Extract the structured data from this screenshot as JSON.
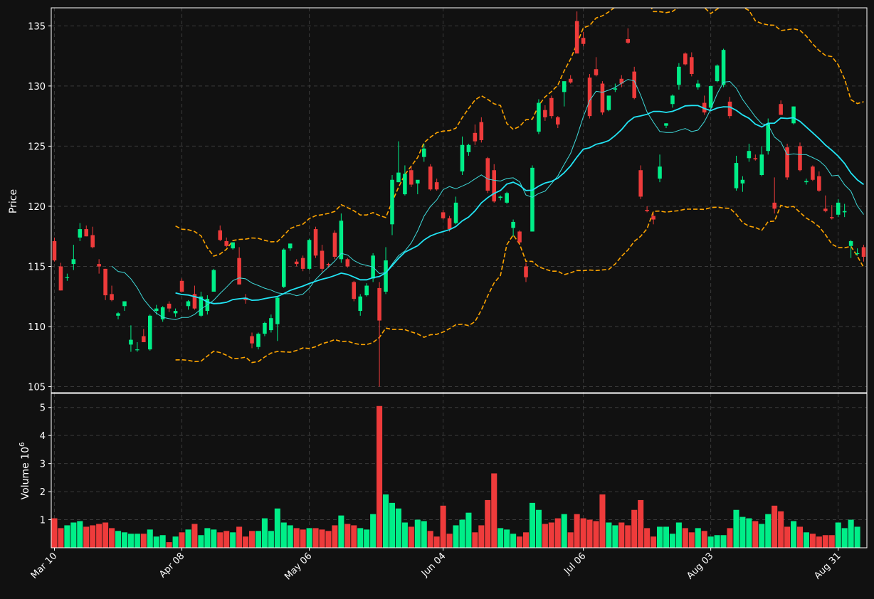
{
  "chart_data": [
    {
      "type": "candlestick",
      "panel": "price",
      "ylabel": "Price",
      "ylim": [
        104.5,
        136.5
      ],
      "yticks": [
        105,
        110,
        115,
        120,
        125,
        130,
        135
      ],
      "xtick_labels": [
        "Mar 10",
        "Apr 08",
        "May 06",
        "Jun 04",
        "Jul 06",
        "Aug 03",
        "Aug 31"
      ],
      "grid": true,
      "colors": {
        "up": "#00ee88",
        "down": "#ee3b3b",
        "mav_short": "#3fd9d9",
        "mav_long": "#22e5f5",
        "bollinger": "#ffa500",
        "background": "#111111",
        "grid": "#3a3a3a"
      },
      "ohlc": [
        [
          117.1,
          117.4,
          115.4,
          115.5
        ],
        [
          115.0,
          115.3,
          113.0,
          113.0
        ],
        [
          114.1,
          114.4,
          113.8,
          114.1
        ],
        [
          115.2,
          116.8,
          114.7,
          115.6
        ],
        [
          117.4,
          118.6,
          117.1,
          118.1
        ],
        [
          118.1,
          118.4,
          117.5,
          117.5
        ],
        [
          117.6,
          118.3,
          116.5,
          116.6
        ],
        [
          115.2,
          115.6,
          114.4,
          115.0
        ],
        [
          114.8,
          114.8,
          112.2,
          112.6
        ],
        [
          112.7,
          113.4,
          112.1,
          112.2
        ],
        [
          110.9,
          111.2,
          110.6,
          111.1
        ],
        [
          111.7,
          112.0,
          111.3,
          112.1
        ],
        [
          108.5,
          110.1,
          107.9,
          108.9
        ],
        [
          108.1,
          108.7,
          107.9,
          108.1
        ],
        [
          109.2,
          109.8,
          108.7,
          108.7
        ],
        [
          108.1,
          111.0,
          108.0,
          110.9
        ],
        [
          111.3,
          111.8,
          111.0,
          111.5
        ],
        [
          110.6,
          111.7,
          110.4,
          111.6
        ],
        [
          111.9,
          112.1,
          111.2,
          111.5
        ],
        [
          111.1,
          111.5,
          110.8,
          111.3
        ],
        [
          113.8,
          114.0,
          112.9,
          112.9
        ],
        [
          111.7,
          112.2,
          111.4,
          112.1
        ],
        [
          112.7,
          113.4,
          111.4,
          111.5
        ],
        [
          110.9,
          112.9,
          110.8,
          112.5
        ],
        [
          111.3,
          112.6,
          111.0,
          112.3
        ],
        [
          112.9,
          114.8,
          112.9,
          114.7
        ],
        [
          118.0,
          118.4,
          117.1,
          117.2
        ],
        [
          117.1,
          117.4,
          116.6,
          116.7
        ],
        [
          116.5,
          117.0,
          116.4,
          117.0
        ],
        [
          115.7,
          116.6,
          113.5,
          113.5
        ],
        [
          112.4,
          112.7,
          111.9,
          112.2
        ],
        [
          109.2,
          109.5,
          108.2,
          108.6
        ],
        [
          108.3,
          109.5,
          108.1,
          109.4
        ],
        [
          109.4,
          110.4,
          109.2,
          110.3
        ],
        [
          109.7,
          111.0,
          109.5,
          110.7
        ],
        [
          110.2,
          112.5,
          108.8,
          112.4
        ],
        [
          113.3,
          116.5,
          113.2,
          116.4
        ],
        [
          116.5,
          116.9,
          116.3,
          116.9
        ],
        [
          115.4,
          115.6,
          115.0,
          115.2
        ],
        [
          115.7,
          115.9,
          114.6,
          114.8
        ],
        [
          114.8,
          117.3,
          114.7,
          117.2
        ],
        [
          118.1,
          118.3,
          115.7,
          115.9
        ],
        [
          116.3,
          116.8,
          114.5,
          114.8
        ],
        [
          115.2,
          115.3,
          114.9,
          115.1
        ],
        [
          117.8,
          118.0,
          115.6,
          115.8
        ],
        [
          115.6,
          119.4,
          115.3,
          118.8
        ],
        [
          115.6,
          115.7,
          114.9,
          115.0
        ],
        [
          113.7,
          113.8,
          112.1,
          112.3
        ],
        [
          111.3,
          112.7,
          110.9,
          112.5
        ],
        [
          112.6,
          113.6,
          112.5,
          113.4
        ],
        [
          114.0,
          116.1,
          113.7,
          115.9
        ],
        [
          113.2,
          113.7,
          105.0,
          110.5
        ],
        [
          112.9,
          116.6,
          112.7,
          115.5
        ],
        [
          118.5,
          122.6,
          117.6,
          122.2
        ],
        [
          122.0,
          125.4,
          122.0,
          122.8
        ],
        [
          121.0,
          123.4,
          120.9,
          122.7
        ],
        [
          123.0,
          123.3,
          121.6,
          121.8
        ],
        [
          121.9,
          122.1,
          121.0,
          122.2
        ],
        [
          124.1,
          125.2,
          123.7,
          124.8
        ],
        [
          123.3,
          123.5,
          121.3,
          121.4
        ],
        [
          122.0,
          122.3,
          121.3,
          121.4
        ],
        [
          119.5,
          119.7,
          118.9,
          119.0
        ],
        [
          119.0,
          119.2,
          117.9,
          118.1
        ],
        [
          118.6,
          120.8,
          118.5,
          120.3
        ],
        [
          122.9,
          125.8,
          122.6,
          125.1
        ],
        [
          124.5,
          125.2,
          124.2,
          125.1
        ],
        [
          126.1,
          126.8,
          125.1,
          125.4
        ],
        [
          127.0,
          127.4,
          125.3,
          125.5
        ],
        [
          124.0,
          124.1,
          121.1,
          121.3
        ],
        [
          123.0,
          123.5,
          120.3,
          120.4
        ],
        [
          120.7,
          120.9,
          120.5,
          120.8
        ],
        [
          120.3,
          121.2,
          120.2,
          121.1
        ],
        [
          118.2,
          118.9,
          117.5,
          118.7
        ],
        [
          117.9,
          118.0,
          116.9,
          117.0
        ],
        [
          115.0,
          115.3,
          113.7,
          114.1
        ],
        [
          117.9,
          123.4,
          117.9,
          123.2
        ],
        [
          126.2,
          128.9,
          126.0,
          128.6
        ],
        [
          128.0,
          128.4,
          127.1,
          127.4
        ],
        [
          129.0,
          129.2,
          127.3,
          127.5
        ],
        [
          127.4,
          127.5,
          126.5,
          126.8
        ],
        [
          129.5,
          130.3,
          128.3,
          130.4
        ],
        [
          130.6,
          130.9,
          130.2,
          130.3
        ],
        [
          135.4,
          136.2,
          132.8,
          132.7
        ],
        [
          134.0,
          134.5,
          133.3,
          133.5
        ],
        [
          130.7,
          131.0,
          127.3,
          127.5
        ],
        [
          131.4,
          132.4,
          130.8,
          130.9
        ],
        [
          130.2,
          130.4,
          127.6,
          127.8
        ],
        [
          128.0,
          129.1,
          127.9,
          129.2
        ],
        [
          129.7,
          130.2,
          129.5,
          129.8
        ],
        [
          130.6,
          130.9,
          129.9,
          130.2
        ],
        [
          133.9,
          134.8,
          133.5,
          133.6
        ],
        [
          131.2,
          131.6,
          128.9,
          129.0
        ],
        [
          123.0,
          123.4,
          120.6,
          120.8
        ],
        [
          119.7,
          120.0,
          119.5,
          119.6
        ],
        [
          119.2,
          119.4,
          118.5,
          118.9
        ],
        [
          122.3,
          124.3,
          122.0,
          123.3
        ],
        [
          126.7,
          126.9,
          126.5,
          126.9
        ],
        [
          128.5,
          129.3,
          128.2,
          129.2
        ],
        [
          130.1,
          131.9,
          129.7,
          131.6
        ],
        [
          132.7,
          132.8,
          131.7,
          131.8
        ],
        [
          132.4,
          132.8,
          130.8,
          131.0
        ],
        [
          129.9,
          130.5,
          129.7,
          130.2
        ],
        [
          128.6,
          129.2,
          127.6,
          127.8
        ],
        [
          128.2,
          130.0,
          128.1,
          130.0
        ],
        [
          130.4,
          131.8,
          130.3,
          131.7
        ],
        [
          130.1,
          133.1,
          129.9,
          133.0
        ],
        [
          128.7,
          129.1,
          127.3,
          127.5
        ],
        [
          121.5,
          124.2,
          121.3,
          123.6
        ],
        [
          121.9,
          122.5,
          121.2,
          122.2
        ],
        [
          124.0,
          125.2,
          123.7,
          124.6
        ],
        [
          124.0,
          124.3,
          123.8,
          123.9
        ],
        [
          122.6,
          125.0,
          122.5,
          124.3
        ],
        [
          124.6,
          127.3,
          124.3,
          126.9
        ],
        [
          120.3,
          122.4,
          119.4,
          119.8
        ],
        [
          128.5,
          128.8,
          127.6,
          127.6
        ],
        [
          124.9,
          125.2,
          122.2,
          122.4
        ],
        [
          126.9,
          128.3,
          126.8,
          128.3
        ],
        [
          125.0,
          125.3,
          122.9,
          123.0
        ],
        [
          122.0,
          122.3,
          121.8,
          122.1
        ],
        [
          123.3,
          123.4,
          122.1,
          122.2
        ],
        [
          122.5,
          122.9,
          121.2,
          121.3
        ],
        [
          119.8,
          120.9,
          119.5,
          119.6
        ],
        [
          119.1,
          120.1,
          118.9,
          119.0
        ],
        [
          119.3,
          120.6,
          119.1,
          120.3
        ],
        [
          119.5,
          120.2,
          119.1,
          119.6
        ],
        [
          116.7,
          117.2,
          115.7,
          117.1
        ],
        [
          116.1,
          116.5,
          115.9,
          116.1
        ],
        [
          116.6,
          116.8,
          115.4,
          115.8
        ]
      ],
      "volume_millions": [
        1.05,
        0.7,
        0.8,
        0.9,
        0.95,
        0.75,
        0.8,
        0.85,
        0.9,
        0.7,
        0.6,
        0.55,
        0.5,
        0.5,
        0.5,
        0.65,
        0.4,
        0.45,
        0.2,
        0.4,
        0.55,
        0.65,
        0.85,
        0.45,
        0.7,
        0.65,
        0.55,
        0.6,
        0.55,
        0.75,
        0.4,
        0.6,
        0.6,
        1.05,
        0.6,
        1.4,
        0.9,
        0.8,
        0.7,
        0.65,
        0.7,
        0.7,
        0.65,
        0.6,
        0.8,
        1.15,
        0.85,
        0.8,
        0.7,
        0.65,
        1.2,
        5.05,
        1.9,
        1.6,
        1.4,
        0.9,
        0.75,
        1.0,
        0.95,
        0.6,
        0.4,
        1.5,
        0.5,
        0.8,
        1.0,
        1.25,
        0.55,
        0.8,
        1.7,
        2.65,
        0.7,
        0.65,
        0.5,
        0.4,
        0.55,
        1.6,
        1.35,
        0.85,
        0.9,
        1.05,
        1.2,
        0.55,
        1.2,
        1.05,
        1.0,
        0.95,
        1.9,
        0.9,
        0.8,
        0.9,
        0.8,
        1.35,
        1.7,
        0.7,
        0.4,
        0.75,
        0.75,
        0.5,
        0.9,
        0.7,
        0.55,
        0.7,
        0.6,
        0.4,
        0.45,
        0.45,
        0.7,
        1.35,
        1.1,
        1.05,
        0.95,
        0.85,
        1.2,
        1.5,
        1.3,
        0.75,
        0.95,
        0.75,
        0.55,
        0.5,
        0.4,
        0.45,
        0.45,
        0.9,
        0.7,
        1.0,
        0.75
      ]
    },
    {
      "type": "bar",
      "panel": "volume",
      "ylabel": "Volume  10",
      "ylabel_exponent": "6",
      "ylim": [
        0,
        5.5
      ],
      "yticks": [
        1,
        2,
        3,
        4,
        5
      ]
    }
  ]
}
